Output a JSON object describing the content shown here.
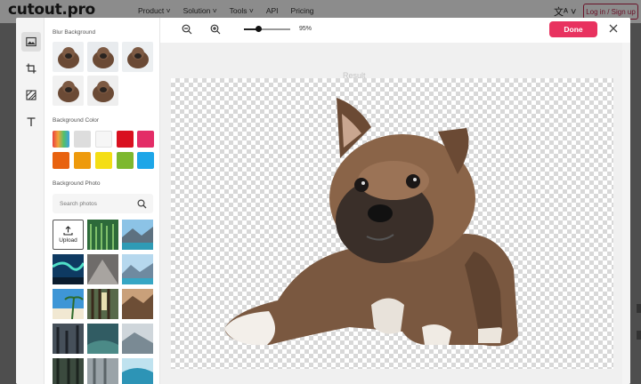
{
  "site": {
    "logo": "cutout.pro",
    "nav": [
      "Product ˅",
      "Solution ˅",
      "Tools ˅",
      "API",
      "Pricing"
    ],
    "lang_icon": "translate-icon",
    "login_label": "Log in / Sign up"
  },
  "editor": {
    "rail_icons": [
      "image-icon",
      "crop-icon",
      "background-erase-icon",
      "text-icon"
    ],
    "blur_background_title": "Blur Background",
    "background_color_title": "Background Color",
    "background_photo_title": "Background Photo",
    "search_placeholder": "Search photos",
    "upload_label": "Upload",
    "zoom_level": "95%",
    "zoom_fraction": 0.3,
    "done_label": "Done",
    "workspace_title": "Result",
    "colors": [
      "#dddddd",
      "#f6f6f6",
      "#d9101f",
      "#e32d67",
      "#e8620f",
      "#ee9a0c",
      "#f4de15",
      "#7db82e",
      "#1da6e8"
    ]
  }
}
